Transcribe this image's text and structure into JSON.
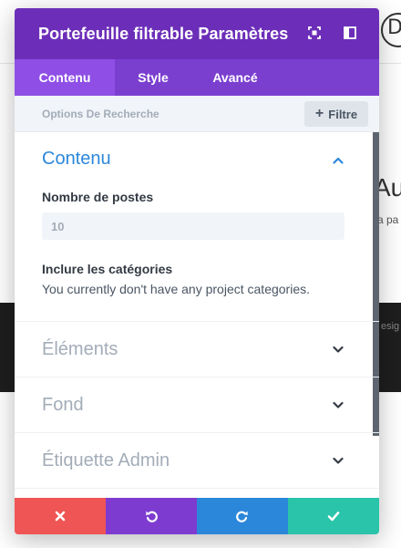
{
  "modal": {
    "title": "Portefeuille filtrable Paramètres"
  },
  "tabs": [
    {
      "label": "Contenu",
      "active": true
    },
    {
      "label": "Style",
      "active": false
    },
    {
      "label": "Avancé",
      "active": false
    }
  ],
  "search": {
    "label": "Options De Recherche",
    "filter_label": "Filtre"
  },
  "sections": {
    "content": {
      "title": "Contenu",
      "posts_label": "Nombre de postes",
      "posts_value": "10",
      "categories_label": "Inclure les catégories",
      "categories_note": "You currently don't have any project categories."
    },
    "elements": {
      "title": "Éléments"
    },
    "background": {
      "title": "Fond"
    },
    "admin_label": {
      "title": "Étiquette Admin"
    }
  },
  "background_page": {
    "logo_letter": "D",
    "title": "Au",
    "subtitle": "a pa",
    "dark_text": "esig"
  },
  "icons": {
    "header_expand": "expand-icon",
    "header_columns": "columns-icon",
    "cancel": "close-icon",
    "undo": "undo-icon",
    "redo": "redo-icon",
    "save": "check-icon"
  },
  "colors": {
    "header": "#6c2eb9",
    "tabs": "#7b3fd0",
    "tab_active": "#8f4fe6",
    "accent_blue": "#2b87da",
    "cancel": "#ef5555",
    "undo": "#7e3bd0",
    "redo": "#2b87da",
    "save": "#29c4a9"
  }
}
